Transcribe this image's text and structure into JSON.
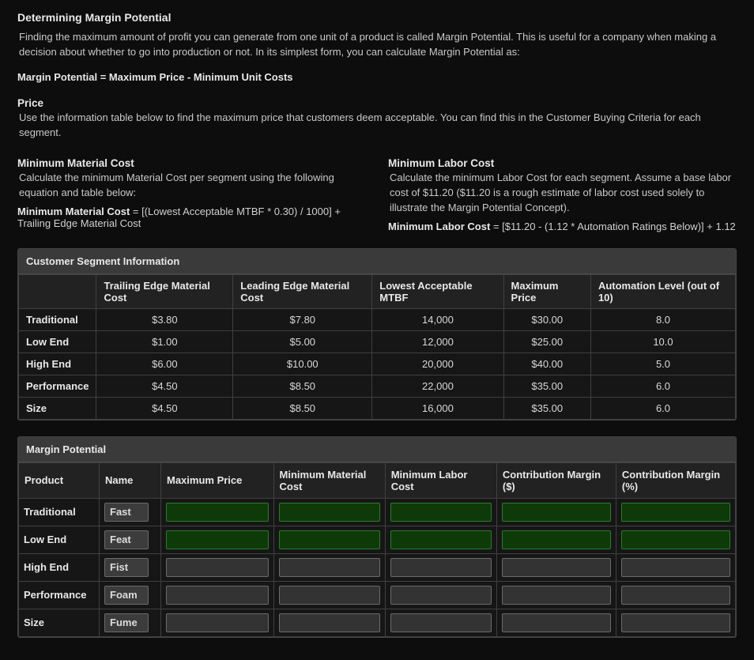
{
  "heading": "Determining Margin Potential",
  "intro": "Finding the maximum amount of profit you can generate from one unit of a product is called Margin Potential. This is useful for a company when making a decision about whether to go into production or not. In its simplest form, you can calculate Margin Potential as:",
  "formula_main": "Margin Potential = Maximum Price - Minimum Unit Costs",
  "price": {
    "title": "Price",
    "body": "Use the information table below to find the maximum price that customers deem acceptable. You can find this in the Customer Buying Criteria for each segment."
  },
  "mmc": {
    "title": "Minimum Material Cost",
    "body": "Calculate the minimum Material Cost per segment using the following equation and table below:",
    "eq_label": "Minimum Material Cost",
    "eq_rest": " = [(Lowest Acceptable MTBF * 0.30) / 1000] + Trailing Edge Material Cost"
  },
  "mlc": {
    "title": "Minimum Labor Cost",
    "body": "Calculate the minimum Labor Cost for each segment. Assume a base labor cost of $11.20 ($11.20 is a rough estimate of labor cost used solely to illustrate the Margin Potential Concept).",
    "eq_label": "Minimum Labor Cost",
    "eq_rest": " = [$11.20 - (1.12 * Automation Ratings Below)] + 1.12"
  },
  "csi": {
    "title": "Customer Segment Information",
    "headers": [
      "",
      "Trailing Edge Material Cost",
      "Leading Edge Material Cost",
      "Lowest Acceptable MTBF",
      "Maximum Price",
      "Automation Level (out of 10)"
    ],
    "rows": [
      {
        "seg": "Traditional",
        "te": "$3.80",
        "le": "$7.80",
        "mtbf": "14,000",
        "max": "$30.00",
        "auto": "8.0"
      },
      {
        "seg": "Low End",
        "te": "$1.00",
        "le": "$5.00",
        "mtbf": "12,000",
        "max": "$25.00",
        "auto": "10.0"
      },
      {
        "seg": "High End",
        "te": "$6.00",
        "le": "$10.00",
        "mtbf": "20,000",
        "max": "$40.00",
        "auto": "5.0"
      },
      {
        "seg": "Performance",
        "te": "$4.50",
        "le": "$8.50",
        "mtbf": "22,000",
        "max": "$35.00",
        "auto": "6.0"
      },
      {
        "seg": "Size",
        "te": "$4.50",
        "le": "$8.50",
        "mtbf": "16,000",
        "max": "$35.00",
        "auto": "6.0"
      }
    ]
  },
  "mp": {
    "title": "Margin Potential",
    "headers": [
      "Product",
      "Name",
      "Maximum Price",
      "Minimum Material Cost",
      "Minimum Labor Cost",
      "Contribution Margin ($)",
      "Contribution Margin (%)"
    ],
    "rows": [
      {
        "seg": "Traditional",
        "name": "Fast",
        "style": "dark-green"
      },
      {
        "seg": "Low End",
        "name": "Feat",
        "style": "dark-green"
      },
      {
        "seg": "High End",
        "name": "Fist",
        "style": "gray"
      },
      {
        "seg": "Performance",
        "name": "Foam",
        "style": "gray"
      },
      {
        "seg": "Size",
        "name": "Fume",
        "style": "gray"
      }
    ]
  }
}
